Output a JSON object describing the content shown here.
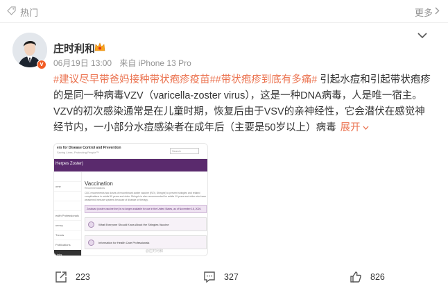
{
  "topbar": {
    "hot_label": "热门",
    "more_label": "更多"
  },
  "post": {
    "username": "庄时利和",
    "date": "06月19日 13:00",
    "source": "来自 iPhone 13 Pro",
    "verify_mark": "v",
    "topics": [
      "#建议尽早带爸妈接种带状疱疹疫苗#",
      "#带状疱疹到底有多痛#"
    ],
    "text": "引起水痘和引起带状疱疹的是同一种病毒VZV（varicella-zoster virus），这是一种DNA病毒，人是唯一宿主。VZV的初次感染通常是在儿童时期，恢复后由于VSV的亲神经性，它会潜伏在感觉神经节内，一小部分水痘感染者在成年后（主要是50岁以上）病毒",
    "expand_label": "展开"
  },
  "thumbnail": {
    "org_line": "ers for Disease Control and Prevention",
    "org_sub": "Saving Lives, Protecting People™",
    "search_placeholder": "Search",
    "band_text": "Herpes Zoster)",
    "title": "Vaccination",
    "subtitle": "Recommendations",
    "para": "CDC recommends two doses of recombinant zoster vaccine (RZV, Shingrix) to prevent shingles and related complications in adults 50 years and older. Shingrix is also recommended for adults 19 years and older who have weakened immune systems because of disease or therapy.",
    "notice": "Zostavax (zoster vaccine live) is no longer available for use in the United States, as of November 18, 2020.",
    "side_items": [
      "",
      "ome",
      "",
      "",
      "ealth Professionals",
      "uency",
      "Trends",
      "Publications",
      "",
      "Links",
      "ning"
    ],
    "card1": "What Everyone Should Know About the Shingles Vaccine",
    "card2": "Information for Health Care Professionals",
    "watermark": "@庄时利和"
  },
  "actions": {
    "share_count": "223",
    "comment_count": "327",
    "like_count": "826"
  },
  "colors": {
    "accent": "#eb7350",
    "verify": "#f25c24",
    "cdc_purple": "#5a2a6d"
  }
}
